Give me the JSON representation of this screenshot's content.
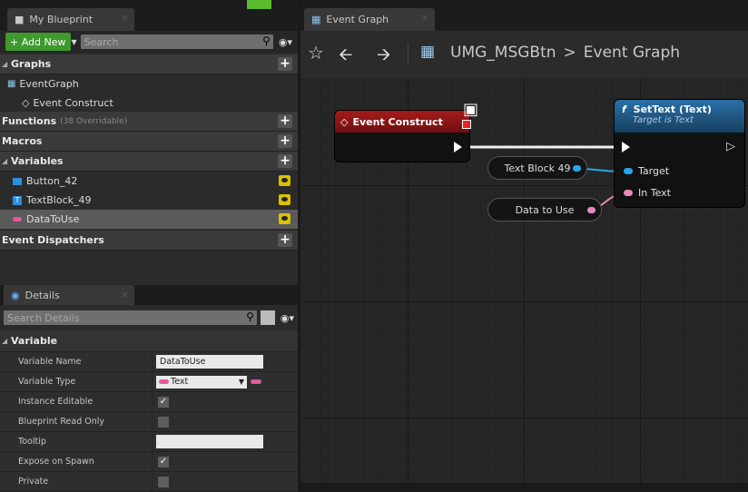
{
  "left_tab": {
    "title": "My Blueprint"
  },
  "left_toolbar": {
    "add_new": "+ Add New",
    "search_placeholder": "Search"
  },
  "sections": {
    "graphs": "Graphs",
    "event_graph": "EventGraph",
    "event_construct": "Event Construct",
    "functions": "Functions",
    "functions_sub": "(38 Overridable)",
    "macros": "Macros",
    "variables": "Variables",
    "event_dispatchers": "Event Dispatchers"
  },
  "variables": [
    {
      "name": "Button_42",
      "color": "#2b8fe0"
    },
    {
      "name": "TextBlock_49",
      "color": "#2b8fe0"
    },
    {
      "name": "DataToUse",
      "color": "#e05a9a"
    }
  ],
  "details": {
    "tab": "Details",
    "search_placeholder": "Search Details",
    "section": "Variable",
    "rows": [
      {
        "label": "Variable Name",
        "value": "DataToUse"
      },
      {
        "label": "Variable Type",
        "value": "Text"
      },
      {
        "label": "Instance Editable"
      },
      {
        "label": "Blueprint Read Only"
      },
      {
        "label": "Tooltip",
        "value": ""
      },
      {
        "label": "Expose on Spawn"
      },
      {
        "label": "Private"
      }
    ]
  },
  "right_tab": {
    "title": "Event Graph"
  },
  "breadcrumb": {
    "blueprint": "UMG_MSGBtn",
    "separator": ">",
    "graph": "Event Graph"
  },
  "nodes": {
    "event_construct": "Event Construct",
    "settext_title": "SetText (Text)",
    "settext_subtitle": "Target is Text",
    "target_pin": "Target",
    "intext_pin": "In Text",
    "textblock_var": "Text Block 49",
    "data_var": "Data to Use"
  },
  "colors": {
    "accent_green": "#3e9a2c",
    "event_red": "#8a1414",
    "function_blue": "#1f5a8c",
    "object_pin": "#27a7e7",
    "text_pin": "#e888b6"
  }
}
